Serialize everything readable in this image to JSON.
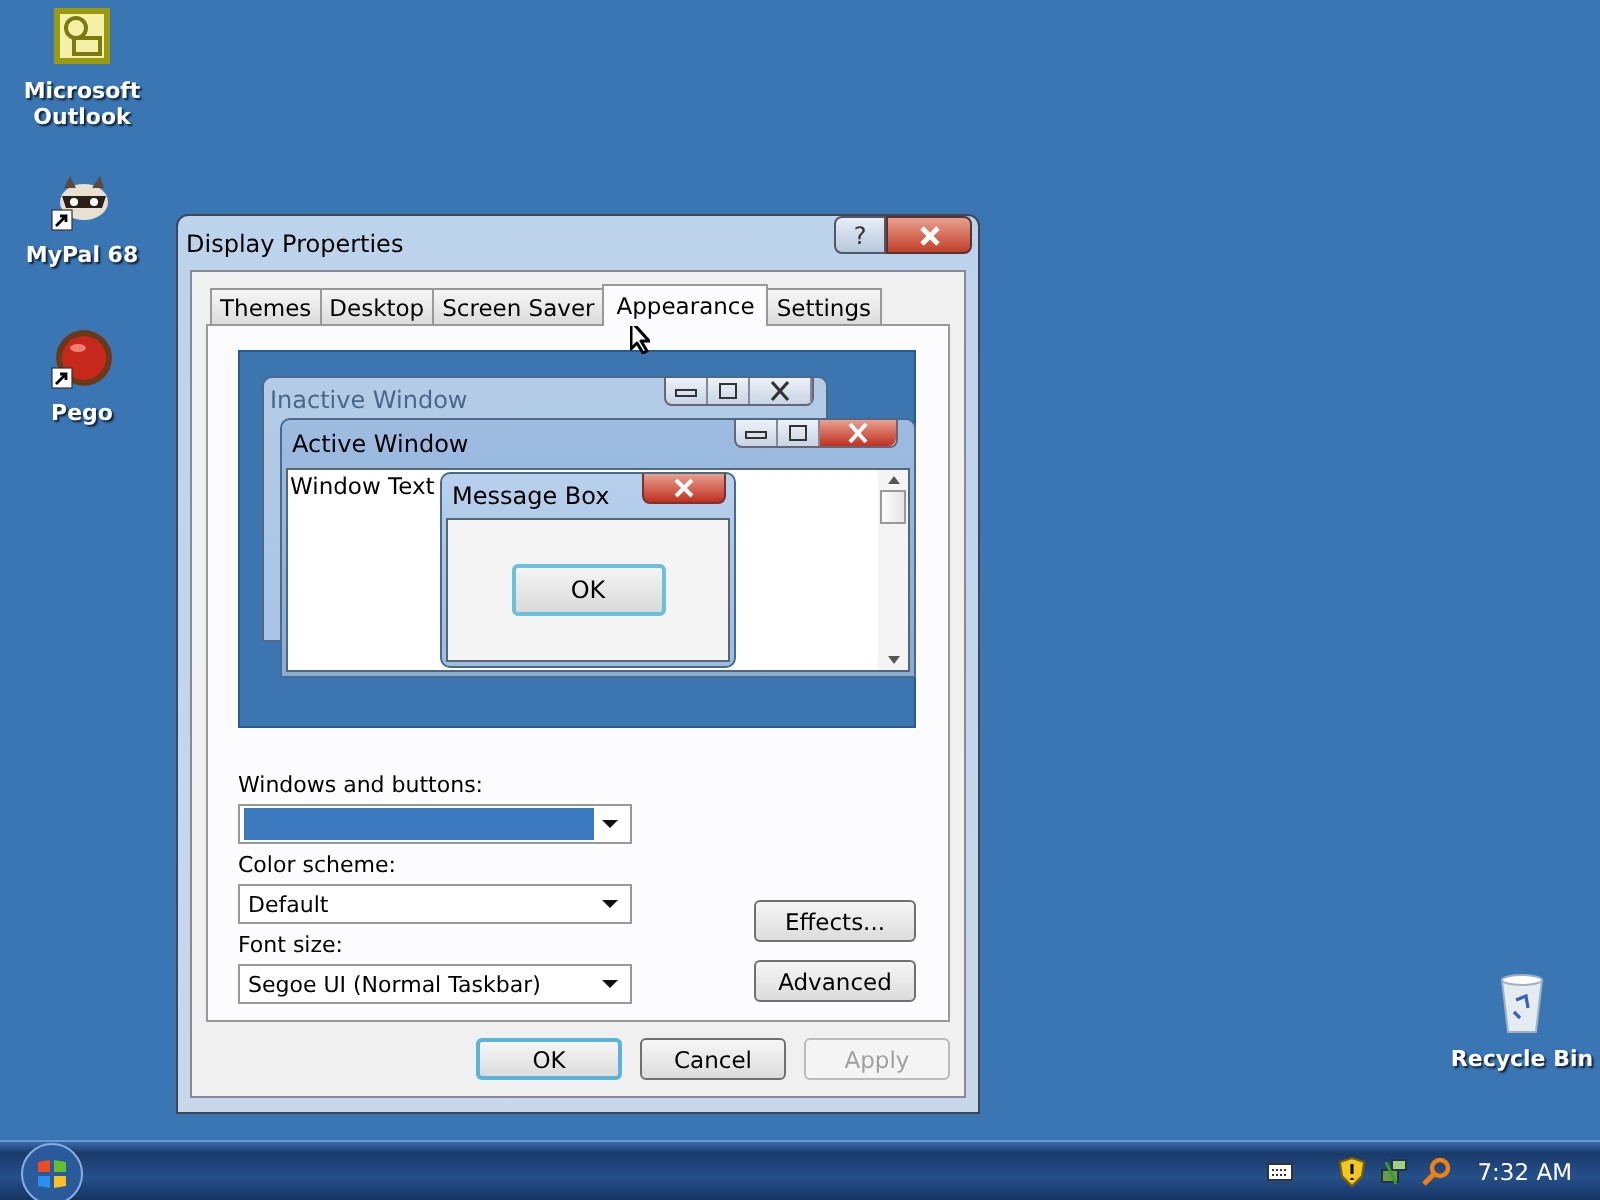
{
  "desktop_icons": [
    {
      "label": "Microsoft Outlook",
      "kind": "outlook",
      "shortcut": false
    },
    {
      "label": "MyPal 68",
      "kind": "raccoon",
      "shortcut": true
    },
    {
      "label": "Pego",
      "kind": "ball",
      "shortcut": true
    },
    {
      "label": "Recycle Bin",
      "kind": "bin",
      "shortcut": false
    }
  ],
  "dialog": {
    "title": "Display Properties",
    "help": "?",
    "tabs": [
      {
        "label": "Themes",
        "selected": false
      },
      {
        "label": "Desktop",
        "selected": false
      },
      {
        "label": "Screen Saver",
        "selected": false
      },
      {
        "label": "Appearance",
        "selected": true
      },
      {
        "label": "Settings",
        "selected": false
      }
    ],
    "preview": {
      "inactive_title": "Inactive Window",
      "active_title": "Active Window",
      "window_text": "Window Text",
      "message_title": "Message Box",
      "message_button": "OK"
    },
    "fields": [
      {
        "label": "Windows and buttons:",
        "highlighted": true
      },
      {
        "label": "Color scheme:",
        "value": "Default",
        "highlighted": false
      },
      {
        "label": "Font size:",
        "value": "Segoe UI (Normal Taskbar)",
        "highlighted": false
      }
    ],
    "side_buttons": [
      "Effects...",
      "Advanced"
    ],
    "buttons": [
      {
        "label": "OK",
        "default": true,
        "disabled": false
      },
      {
        "label": "Cancel",
        "default": false,
        "disabled": false
      },
      {
        "label": "Apply",
        "default": false,
        "disabled": true
      }
    ]
  },
  "taskbar": {
    "clock": "7:32 AM"
  }
}
